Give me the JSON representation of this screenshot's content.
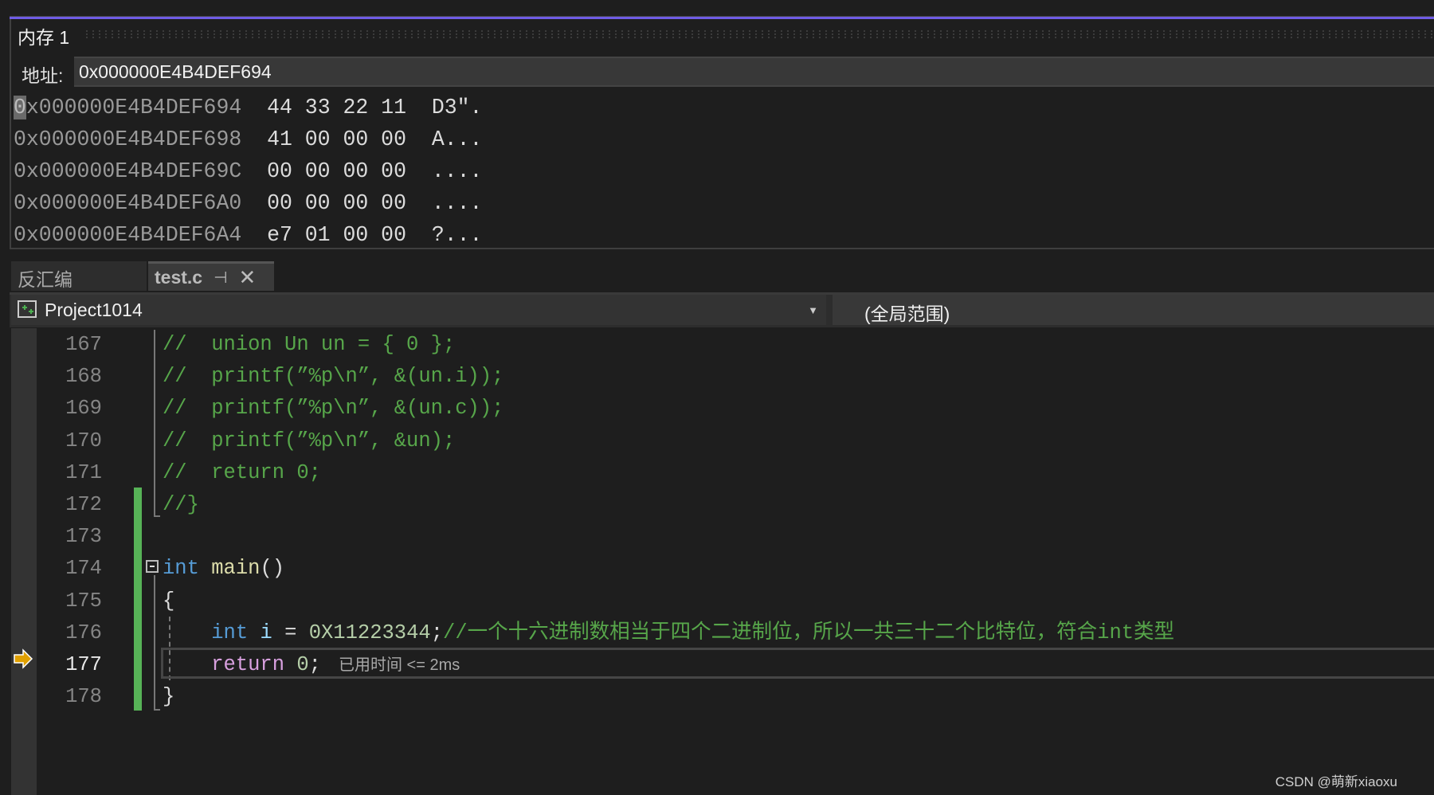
{
  "memory_window": {
    "title": "内存 1",
    "address_label": "地址:",
    "address_value": "0x000000E4B4DEF694",
    "rows": [
      {
        "address": "0x000000E4B4DEF694",
        "bytes": "44 33 22 11",
        "ascii": "D3″."
      },
      {
        "address": "0x000000E4B4DEF698",
        "bytes": "41 00 00 00",
        "ascii": "A..."
      },
      {
        "address": "0x000000E4B4DEF69C",
        "bytes": "00 00 00 00",
        "ascii": "...."
      },
      {
        "address": "0x000000E4B4DEF6A0",
        "bytes": "00 00 00 00",
        "ascii": "...."
      },
      {
        "address": "0x000000E4B4DEF6A4",
        "bytes": "e7 01 00 00",
        "ascii": "?..."
      }
    ]
  },
  "tabs": [
    {
      "label": "反汇编",
      "active": false
    },
    {
      "label": "test.c",
      "active": true
    }
  ],
  "navbar": {
    "project": "Project1014",
    "scope": "(全局范围)"
  },
  "editor": {
    "current_line": 177,
    "lines": [
      {
        "n": "167",
        "tokens": [
          [
            "cm",
            "//  union Un un = { 0 };"
          ]
        ]
      },
      {
        "n": "168",
        "tokens": [
          [
            "cm",
            "//  printf(”%p\\n”, &(un.i));"
          ]
        ]
      },
      {
        "n": "169",
        "tokens": [
          [
            "cm",
            "//  printf(”%p\\n”, &(un.c));"
          ]
        ]
      },
      {
        "n": "170",
        "tokens": [
          [
            "cm",
            "//  printf(”%p\\n”, &un);"
          ]
        ]
      },
      {
        "n": "171",
        "tokens": [
          [
            "cm",
            "//  return 0;"
          ]
        ]
      },
      {
        "n": "172",
        "tokens": [
          [
            "cm",
            "//}"
          ]
        ]
      },
      {
        "n": "173",
        "tokens": []
      },
      {
        "n": "174",
        "tokens": [
          [
            "kw",
            "int"
          ],
          [
            "pl",
            " "
          ],
          [
            "fn",
            "main"
          ],
          [
            "pl",
            "()"
          ]
        ]
      },
      {
        "n": "175",
        "tokens": [
          [
            "pl",
            "{"
          ]
        ]
      },
      {
        "n": "176",
        "tokens": [
          [
            "pl",
            "    "
          ],
          [
            "kw",
            "int"
          ],
          [
            "pl",
            " "
          ],
          [
            "var",
            "i"
          ],
          [
            "pl",
            " = "
          ],
          [
            "num",
            "0X11223344"
          ],
          [
            "pl",
            ";"
          ],
          [
            "cm",
            "//一个十六进制数相当于四个二进制位，所以一共三十二个比特位，符合int类型"
          ]
        ]
      },
      {
        "n": "177",
        "tokens": [
          [
            "pl",
            "    "
          ],
          [
            "ctl",
            "return"
          ],
          [
            "pl",
            " "
          ],
          [
            "num",
            "0"
          ],
          [
            "pl",
            ";"
          ]
        ],
        "hint": "已用时间 <= 2ms"
      },
      {
        "n": "178",
        "tokens": [
          [
            "pl",
            "}"
          ]
        ]
      }
    ]
  },
  "watermark": "CSDN @萌新xiaoxu",
  "colors": {
    "accent": "#6f5ce6",
    "comment": "#57a64a",
    "keyword": "#569cd6",
    "changed_bar": "#57b357",
    "current_arrow": "#e0a000"
  }
}
